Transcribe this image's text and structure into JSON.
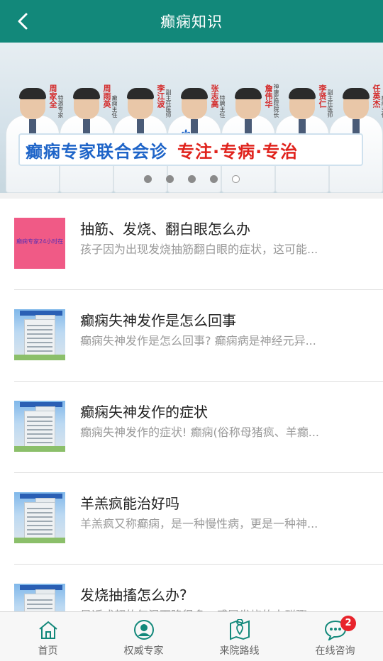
{
  "header": {
    "title": "癫痫知识",
    "back_icon": "chevron-left-icon"
  },
  "banner": {
    "doctors": [
      {
        "name": "周家全",
        "role": "特邀专家"
      },
      {
        "name": "周雨英",
        "role": "癫痫主任"
      },
      {
        "name": "李江波",
        "role": "副主任医师"
      },
      {
        "name": "张志高",
        "role": "特聘主任"
      },
      {
        "name": "詹伟华",
        "role": "神康医院院长"
      },
      {
        "name": "李贤仁",
        "role": "副主任医师"
      },
      {
        "name": "任英杰",
        "role": "癫痫主任"
      }
    ],
    "headline": "癫痫专家联合会诊",
    "slogan": "专注·专病·专治",
    "slide_count": 5,
    "active_slide": 5
  },
  "articles": [
    {
      "title": "抽筋、发烧、翻白眼怎么办",
      "summary": "孩子因为出现发烧抽筋翻白眼的症状，这可能...",
      "thumb_type": "pink",
      "thumb_text": "癫痫专家24小时在线免费咨询"
    },
    {
      "title": "癫痫失神发作是怎么回事",
      "summary": "癫痫失神发作是怎么回事? 癫痫病是神经元异...",
      "thumb_type": "building"
    },
    {
      "title": "癫痫失神发作的症状",
      "summary": "癫痫失神发作的症状! 癫痫(俗称母猪疯、羊癫...",
      "thumb_type": "building"
    },
    {
      "title": "羊羔疯能治好吗",
      "summary": "羊羔疯又称癫痫，是一种慢性病，更是一种神...",
      "thumb_type": "building"
    },
    {
      "title": "发烧抽搐怎么办?",
      "summary": "最近成都的气温下降很多，感冒发烧的人群骤...",
      "thumb_type": "building"
    }
  ],
  "tabbar": [
    {
      "label": "首页",
      "icon": "home-icon"
    },
    {
      "label": "权威专家",
      "icon": "doctor-icon"
    },
    {
      "label": "来院路线",
      "icon": "map-icon"
    },
    {
      "label": "在线咨询",
      "icon": "chat-icon",
      "badge": "2"
    }
  ],
  "colors": {
    "primary": "#12887a",
    "badge": "#e8242c"
  }
}
